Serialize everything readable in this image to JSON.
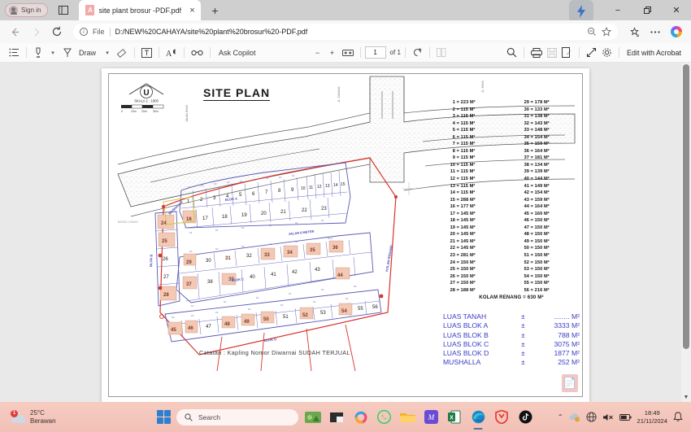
{
  "browser": {
    "signin_label": "Sign in",
    "tab": {
      "title": "site plant brosur -PDF.pdf",
      "favicon": "pdf-icon",
      "close": "×"
    },
    "new_tab": "+",
    "window_controls": {
      "minimize": "−",
      "maximize": "❐",
      "close": "✕"
    },
    "nav": {
      "back": "←",
      "forward": "→",
      "refresh": "↻"
    },
    "omnibox": {
      "scheme_label": "File",
      "url": "D:/NEW%20CAHAYA/site%20plant%20brosur%20-PDF.pdf",
      "zoom_icon": "zoom-out-icon",
      "favorite_icon": "star-icon"
    },
    "toolbar_right": {
      "collections_icon": "collections-icon",
      "more_icon": "ellipsis-icon",
      "copilot_icon": "copilot-icon"
    }
  },
  "pdf_toolbar": {
    "toc_label": "table-of-contents",
    "highlight_label": "highlight",
    "draw_label": "Draw",
    "erase_label": "erase",
    "text_label": "add-text",
    "read_aloud_label": "read-aloud",
    "glasses_label": "reading-view",
    "copilot_label": "Ask Copilot",
    "zoom_out": "−",
    "zoom_in": "+",
    "fit_page": "fit-to-page",
    "page_current": "1",
    "page_of": "of 1",
    "rotate_label": "rotate",
    "layout_label": "page-layout",
    "search_label": "search",
    "print_label": "print",
    "save_label": "save",
    "markup_label": "markup",
    "fullscreen_label": "fullscreen",
    "settings_label": "settings",
    "acrobat_label": "Edit with Acrobat"
  },
  "document": {
    "title": "SITE PLAN",
    "compass": {
      "north_letter": "U",
      "scale_text": "SKALA 1 : 1000",
      "ticks": [
        "0",
        "10m",
        "20m",
        "30m"
      ]
    },
    "note": "Catatan :   Kapling  Nomor  Diwarnai  SUDAH TERJUAL",
    "kolam_renang": "KOLAM RENANG = 630 M²",
    "unit": "M²",
    "legend_left": [
      {
        "no": "1",
        "area": "223"
      },
      {
        "no": "2",
        "area": "115"
      },
      {
        "no": "3",
        "area": "115"
      },
      {
        "no": "4",
        "area": "115"
      },
      {
        "no": "5",
        "area": "115"
      },
      {
        "no": "6",
        "area": "115"
      },
      {
        "no": "7",
        "area": "115"
      },
      {
        "no": "8",
        "area": "115"
      },
      {
        "no": "9",
        "area": "115"
      },
      {
        "no": "10",
        "area": "115"
      },
      {
        "no": "11",
        "area": "115"
      },
      {
        "no": "12",
        "area": "115"
      },
      {
        "no": "13",
        "area": "115"
      },
      {
        "no": "14",
        "area": "115"
      },
      {
        "no": "15",
        "area": "288"
      },
      {
        "no": "16",
        "area": "177"
      },
      {
        "no": "17",
        "area": "145"
      },
      {
        "no": "18",
        "area": "145"
      },
      {
        "no": "19",
        "area": "145"
      },
      {
        "no": "20",
        "area": "145"
      },
      {
        "no": "21",
        "area": "145"
      },
      {
        "no": "22",
        "area": "145"
      },
      {
        "no": "23",
        "area": "281"
      },
      {
        "no": "24",
        "area": "150"
      },
      {
        "no": "25",
        "area": "150"
      },
      {
        "no": "26",
        "area": "150"
      },
      {
        "no": "27",
        "area": "150"
      },
      {
        "no": "28",
        "area": "188"
      }
    ],
    "legend_right": [
      {
        "no": "29",
        "area": "178"
      },
      {
        "no": "30",
        "area": "133"
      },
      {
        "no": "31",
        "area": "138"
      },
      {
        "no": "32",
        "area": "143"
      },
      {
        "no": "33",
        "area": "148"
      },
      {
        "no": "34",
        "area": "154"
      },
      {
        "no": "35",
        "area": "159"
      },
      {
        "no": "36",
        "area": "164"
      },
      {
        "no": "37",
        "area": "181"
      },
      {
        "no": "38",
        "area": "134"
      },
      {
        "no": "39",
        "area": "139"
      },
      {
        "no": "40",
        "area": "144"
      },
      {
        "no": "41",
        "area": "149"
      },
      {
        "no": "42",
        "area": "154"
      },
      {
        "no": "43",
        "area": "159"
      },
      {
        "no": "44",
        "area": "164"
      },
      {
        "no": "45",
        "area": "160"
      },
      {
        "no": "46",
        "area": "150"
      },
      {
        "no": "47",
        "area": "150"
      },
      {
        "no": "48",
        "area": "150"
      },
      {
        "no": "49",
        "area": "150"
      },
      {
        "no": "50",
        "area": "150"
      },
      {
        "no": "51",
        "area": "150"
      },
      {
        "no": "52",
        "area": "150"
      },
      {
        "no": "53",
        "area": "150"
      },
      {
        "no": "54",
        "area": "150"
      },
      {
        "no": "55",
        "area": "150"
      },
      {
        "no": "56",
        "area": "216"
      }
    ],
    "luas": [
      {
        "label": "LUAS TANAH",
        "pm": "±",
        "value": "........",
        "unit": "M²"
      },
      {
        "label": "LUAS BLOK A",
        "pm": "±",
        "value": "3333",
        "unit": "M²"
      },
      {
        "label": "LUAS BLOK B",
        "pm": "±",
        "value": "788",
        "unit": "M²"
      },
      {
        "label": "LUAS BLOK C",
        "pm": "±",
        "value": "3075",
        "unit": "M²"
      },
      {
        "label": "LUAS BLOK D",
        "pm": "±",
        "value": "1877",
        "unit": "M²"
      },
      {
        "label": "MUSHALLA",
        "pm": "±",
        "value": "252",
        "unit": "M²"
      }
    ],
    "block_labels": [
      "BLOK A",
      "BLOK B",
      "BLOK C",
      "BLOK D",
      "MUSHALLA",
      "KOLAM RENANG",
      "JALAN 6 METER",
      "JALAN 8 METER"
    ],
    "sold_units": [
      "16",
      "24",
      "25",
      "28",
      "29",
      "31",
      "33",
      "34",
      "35",
      "36",
      "37",
      "44",
      "45",
      "46",
      "48",
      "49",
      "50",
      "52",
      "54"
    ],
    "colors": {
      "sold_fill": "#f3c8b4",
      "plot_line": "#5a5ab5",
      "boundary_red": "#d8342c",
      "text_blue": "#3b3bc4"
    }
  },
  "taskbar": {
    "weather": {
      "temp": "25°C",
      "condition": "Berawan",
      "badge": "1"
    },
    "start_label": "start-button",
    "search_placeholder": "Search",
    "apps": [
      "widgets-icon",
      "file-explorer-icon",
      "copilot-icon",
      "whatsapp-icon",
      "folder-icon",
      "office-icon",
      "excel-icon",
      "edge-icon",
      "opera-gx-icon",
      "tiktok-icon"
    ],
    "tray": {
      "chevron": "⌃",
      "onedrive": "onedrive-icon",
      "network": "network-icon",
      "volume": "volume-mute-icon",
      "battery": "battery-icon",
      "bell": "notification-icon"
    },
    "time": "18:49",
    "date": "21/11/2024"
  }
}
